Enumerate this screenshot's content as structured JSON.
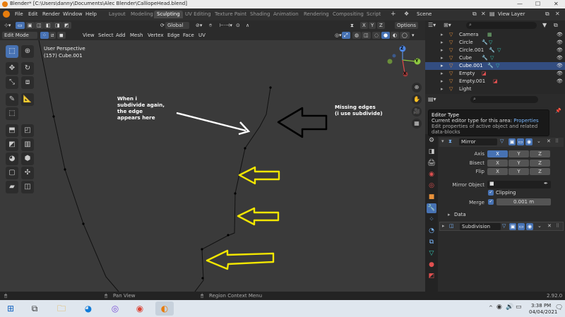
{
  "titlebar": {
    "title": "Blender* [C:\\Users\\danny\\Documents\\Alec Blender\\CalliopeHead.blend]",
    "minimize": "—",
    "maximize": "☐",
    "close": "✕"
  },
  "menubar": {
    "items": [
      "File",
      "Edit",
      "Render",
      "Window",
      "Help"
    ],
    "workspaces": [
      "Layout",
      "Modeling",
      "Sculpting",
      "UV Editing",
      "Texture Paint",
      "Shading",
      "Animation",
      "Rendering",
      "Compositing",
      "Script"
    ],
    "active_workspace": "Sculpting",
    "scene_label": "Scene",
    "view_layer_label": "View Layer"
  },
  "header3d": {
    "orientation": "Global",
    "options": "Options",
    "axes": [
      "X",
      "Y",
      "Z"
    ]
  },
  "header3d_row2": {
    "mode": "Edit Mode",
    "menus": [
      "View",
      "Select",
      "Add",
      "Mesh",
      "Vertex",
      "Edge",
      "Face",
      "UV"
    ]
  },
  "viewport": {
    "perspective": "User Perspective",
    "object_info": "(157) Cube.001",
    "annotation_left": [
      "When i",
      "subdivide again,",
      "the edge",
      "appears here"
    ],
    "annotation_right": [
      "Missing edges",
      "(i use subdivide)"
    ],
    "gizmo_labels": [
      "Z",
      "Y",
      "X"
    ],
    "colors": {
      "background": "#3a3a3a",
      "annotation_arrow_yellow": "#f2e600",
      "annotation_arrow_black": "#000000",
      "annotation_arrow_white": "#ffffff"
    }
  },
  "outliner": {
    "items": [
      {
        "name": "Camera",
        "selected": false
      },
      {
        "name": "Circle",
        "selected": false
      },
      {
        "name": "Circle.001",
        "selected": false
      },
      {
        "name": "Cube",
        "selected": false
      },
      {
        "name": "Cube.001",
        "selected": true
      },
      {
        "name": "Empty",
        "selected": false
      },
      {
        "name": "Empty.001",
        "selected": false
      },
      {
        "name": "Light",
        "selected": false
      }
    ]
  },
  "tooltip": {
    "title": "Editor Type",
    "line2_prefix": "Current editor type for this area:",
    "line2_value": "Properties",
    "line3": "Edit properties of active object and related data-blocks"
  },
  "properties": {
    "mirror_name": "Mirror",
    "axis_label": "Axis",
    "bisect_label": "Bisect",
    "flip_label": "Flip",
    "axes": [
      "X",
      "Y",
      "Z"
    ],
    "mirror_object_label": "Mirror Object",
    "clipping_label": "Clipping",
    "merge_label": "Merge",
    "merge_value": "0.001 m",
    "data_label": "Data",
    "subdivision_name": "Subdivision"
  },
  "statusbar": {
    "pan_view": "Pan View",
    "region_menu": "Region Context Menu",
    "version": "2.92.0"
  },
  "taskbar": {
    "time": "3:38 PM",
    "date": "04/04/2021",
    "chevron": "^"
  }
}
